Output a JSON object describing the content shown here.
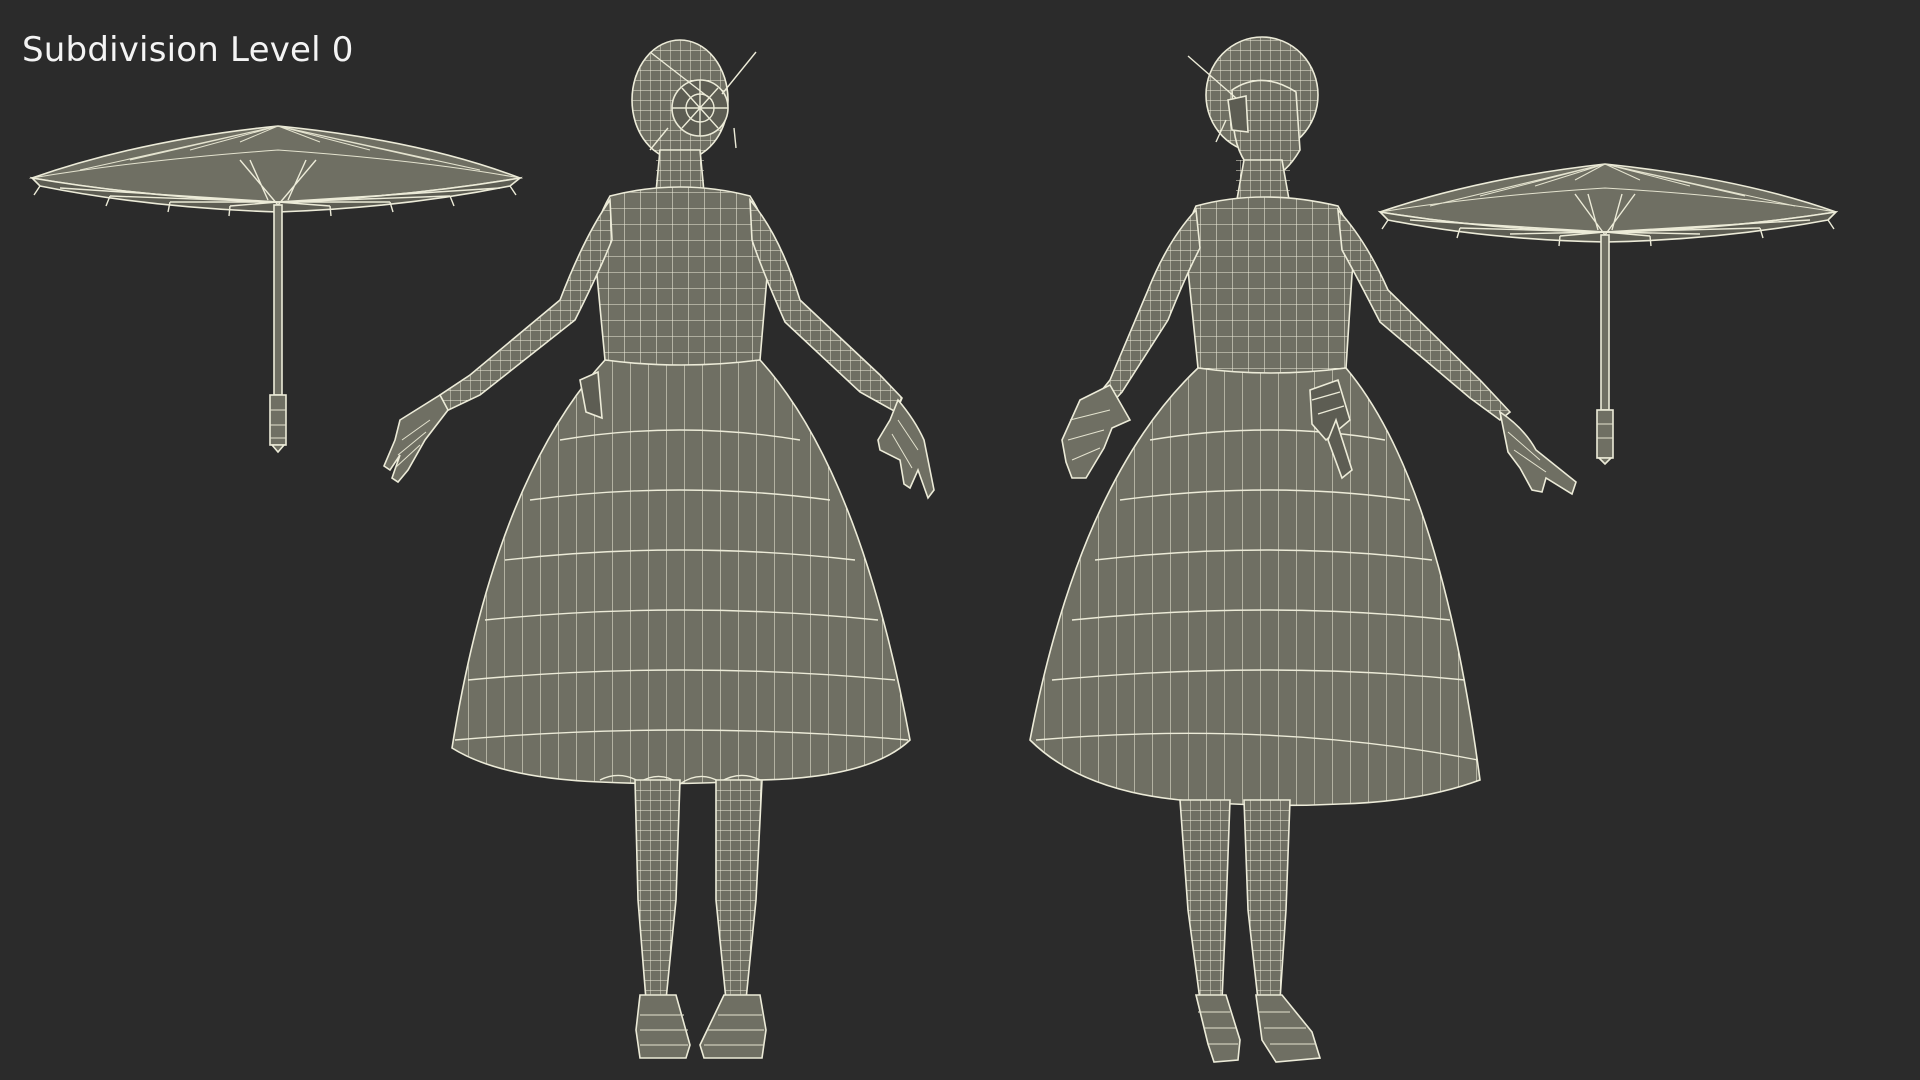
{
  "viewport": {
    "background": "#2b2b2b",
    "label": "Subdivision Level 0",
    "mesh_fill": "#6f6f63",
    "wire_color": "#ecebd8"
  },
  "scene": {
    "objects": [
      "umbrella-left",
      "woman-back-view",
      "woman-front-view",
      "umbrella-right"
    ]
  }
}
